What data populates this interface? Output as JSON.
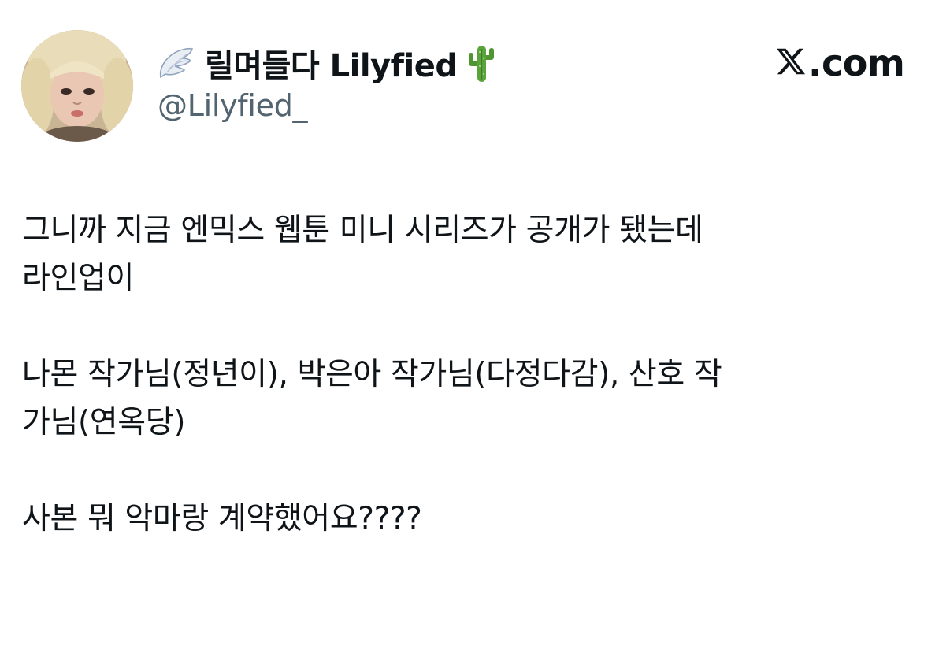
{
  "author": {
    "display_name": "릴며들다 Lilyfied",
    "handle": "@Lilyfied_",
    "name_prefix_icon": "angel-wing-icon",
    "name_suffix_icon": "cactus-icon",
    "avatar_icon": "profile-avatar"
  },
  "brand": {
    "logo_icon": "x-logo-icon",
    "label": ".com"
  },
  "tweet": {
    "paragraph1": {
      "line1": "그니까 지금 엔믹스 웹툰 미니 시리즈가 공개가 됐는데",
      "line2": "라인업이"
    },
    "paragraph2": {
      "line1": "나몬 작가님(정년이), 박은아 작가님(다정다감), 산호 작",
      "line2": "가님(연옥당)"
    },
    "paragraph3": {
      "line1": "사본 뭐 악마랑 계약했어요????"
    }
  },
  "colors": {
    "text_primary": "#0f1419",
    "text_secondary": "#536471",
    "background": "#ffffff",
    "cactus_green": "#5aa43c"
  }
}
